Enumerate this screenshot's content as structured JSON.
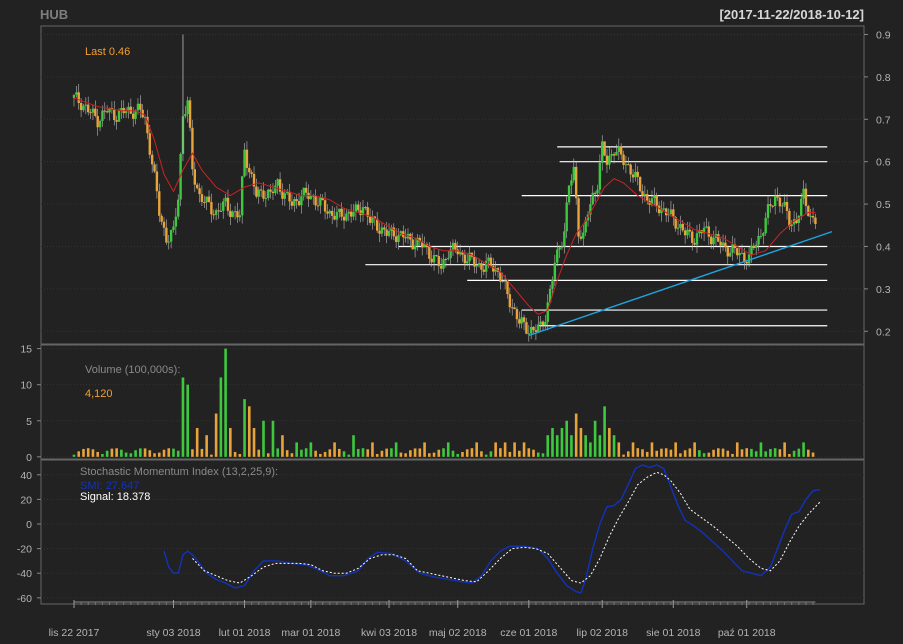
{
  "header": {
    "symbol": "HUB",
    "range": "[2017-11-22/2018-10-12]"
  },
  "colors": {
    "background": "#222222",
    "up_candle": "#3ec83e",
    "down_candle": "#e8a33a",
    "ma_line": "#cc2222",
    "trendline": "#1ea5e0",
    "smi_line": "#1133bb",
    "signal_line": "#ffffff",
    "last_text": "#f0a030"
  },
  "chart_data": [
    {
      "type": "candlestick",
      "panel": "price",
      "annotation_label": "Last",
      "annotation_value": "0.46",
      "yticks": [
        "0.2",
        "0.3",
        "0.4",
        "0.5",
        "0.6",
        "0.7",
        "0.8",
        "0.9"
      ],
      "ylim": [
        0.17,
        0.92
      ],
      "xticks": [
        "lis 22 2017",
        "sty 03 2018",
        "lut 01 2018",
        "mar 01 2018",
        "kwi 03 2018",
        "maj 02 2018",
        "cze 01 2018",
        "lip 02 2018",
        "sie 01 2018",
        "paź 01 2018"
      ],
      "close_path": [
        [
          0,
          0.75
        ],
        [
          3,
          0.74
        ],
        [
          6,
          0.72
        ],
        [
          10,
          0.7
        ],
        [
          14,
          0.72
        ],
        [
          18,
          0.71
        ],
        [
          22,
          0.72
        ],
        [
          25,
          0.72
        ],
        [
          28,
          0.72
        ],
        [
          30,
          0.7
        ],
        [
          33,
          0.6
        ],
        [
          36,
          0.48
        ],
        [
          39,
          0.42
        ],
        [
          42,
          0.43
        ],
        [
          44,
          0.52
        ],
        [
          46,
          0.71
        ],
        [
          48,
          0.74
        ],
        [
          50,
          0.58
        ],
        [
          53,
          0.52
        ],
        [
          56,
          0.5
        ],
        [
          60,
          0.48
        ],
        [
          64,
          0.5
        ],
        [
          67,
          0.48
        ],
        [
          70,
          0.47
        ],
        [
          72,
          0.63
        ],
        [
          74,
          0.58
        ],
        [
          77,
          0.52
        ],
        [
          80,
          0.53
        ],
        [
          83,
          0.52
        ],
        [
          86,
          0.55
        ],
        [
          89,
          0.52
        ],
        [
          92,
          0.5
        ],
        [
          96,
          0.52
        ],
        [
          100,
          0.52
        ],
        [
          104,
          0.5
        ],
        [
          108,
          0.48
        ],
        [
          112,
          0.47
        ],
        [
          116,
          0.48
        ],
        [
          120,
          0.48
        ],
        [
          122,
          0.5
        ],
        [
          125,
          0.46
        ],
        [
          128,
          0.45
        ],
        [
          132,
          0.43
        ],
        [
          136,
          0.43
        ],
        [
          140,
          0.42
        ],
        [
          144,
          0.41
        ],
        [
          148,
          0.4
        ],
        [
          152,
          0.37
        ],
        [
          155,
          0.35
        ],
        [
          158,
          0.39
        ],
        [
          162,
          0.39
        ],
        [
          166,
          0.37
        ],
        [
          170,
          0.36
        ],
        [
          173,
          0.35
        ],
        [
          176,
          0.36
        ],
        [
          179,
          0.34
        ],
        [
          182,
          0.3
        ],
        [
          185,
          0.26
        ],
        [
          188,
          0.22
        ],
        [
          191,
          0.21
        ],
        [
          194,
          0.2
        ],
        [
          197,
          0.21
        ],
        [
          199,
          0.24
        ],
        [
          201,
          0.29
        ],
        [
          203,
          0.36
        ],
        [
          205,
          0.4
        ],
        [
          207,
          0.44
        ],
        [
          209,
          0.54
        ],
        [
          211,
          0.58
        ],
        [
          213,
          0.44
        ],
        [
          215,
          0.42
        ],
        [
          217,
          0.48
        ],
        [
          219,
          0.52
        ],
        [
          221,
          0.55
        ],
        [
          223,
          0.63
        ],
        [
          225,
          0.6
        ],
        [
          228,
          0.63
        ],
        [
          231,
          0.61
        ],
        [
          234,
          0.59
        ],
        [
          238,
          0.55
        ],
        [
          242,
          0.51
        ],
        [
          246,
          0.5
        ],
        [
          250,
          0.48
        ],
        [
          254,
          0.46
        ],
        [
          258,
          0.43
        ],
        [
          262,
          0.42
        ],
        [
          266,
          0.44
        ],
        [
          270,
          0.42
        ],
        [
          274,
          0.4
        ],
        [
          278,
          0.39
        ],
        [
          282,
          0.38
        ],
        [
          285,
          0.37
        ],
        [
          287,
          0.4
        ],
        [
          290,
          0.43
        ],
        [
          293,
          0.48
        ],
        [
          296,
          0.52
        ],
        [
          299,
          0.5
        ],
        [
          302,
          0.46
        ],
        [
          305,
          0.46
        ],
        [
          308,
          0.52
        ],
        [
          311,
          0.47
        ],
        [
          313,
          0.46
        ]
      ],
      "ma_path": [
        [
          0,
          0.75
        ],
        [
          10,
          0.73
        ],
        [
          20,
          0.72
        ],
        [
          26,
          0.72
        ],
        [
          30,
          0.71
        ],
        [
          34,
          0.65
        ],
        [
          38,
          0.57
        ],
        [
          42,
          0.53
        ],
        [
          46,
          0.58
        ],
        [
          50,
          0.62
        ],
        [
          54,
          0.58
        ],
        [
          60,
          0.54
        ],
        [
          66,
          0.52
        ],
        [
          72,
          0.54
        ],
        [
          78,
          0.55
        ],
        [
          84,
          0.54
        ],
        [
          90,
          0.53
        ],
        [
          96,
          0.52
        ],
        [
          102,
          0.52
        ],
        [
          108,
          0.51
        ],
        [
          114,
          0.49
        ],
        [
          120,
          0.48
        ],
        [
          126,
          0.47
        ],
        [
          132,
          0.45
        ],
        [
          138,
          0.43
        ],
        [
          144,
          0.42
        ],
        [
          150,
          0.4
        ],
        [
          156,
          0.39
        ],
        [
          162,
          0.39
        ],
        [
          168,
          0.38
        ],
        [
          174,
          0.36
        ],
        [
          180,
          0.34
        ],
        [
          186,
          0.3
        ],
        [
          192,
          0.26
        ],
        [
          196,
          0.24
        ],
        [
          200,
          0.25
        ],
        [
          204,
          0.32
        ],
        [
          208,
          0.38
        ],
        [
          212,
          0.43
        ],
        [
          216,
          0.46
        ],
        [
          220,
          0.5
        ],
        [
          224,
          0.54
        ],
        [
          228,
          0.56
        ],
        [
          232,
          0.55
        ],
        [
          238,
          0.52
        ],
        [
          244,
          0.5
        ],
        [
          250,
          0.48
        ],
        [
          256,
          0.46
        ],
        [
          262,
          0.44
        ],
        [
          268,
          0.43
        ],
        [
          274,
          0.42
        ],
        [
          280,
          0.4
        ],
        [
          286,
          0.38
        ],
        [
          292,
          0.39
        ],
        [
          298,
          0.43
        ],
        [
          304,
          0.46
        ],
        [
          310,
          0.48
        ],
        [
          313,
          0.48
        ]
      ],
      "support_lines": [
        {
          "from": 204,
          "to": 318,
          "value": 0.635
        },
        {
          "from": 205,
          "to": 318,
          "value": 0.6
        },
        {
          "from": 189,
          "to": 318,
          "value": 0.52
        },
        {
          "from": 137,
          "to": 318,
          "value": 0.4
        },
        {
          "from": 123,
          "to": 318,
          "value": 0.357
        },
        {
          "from": 166,
          "to": 318,
          "value": 0.32
        },
        {
          "from": 189,
          "to": 318,
          "value": 0.25
        },
        {
          "from": 196,
          "to": 318,
          "value": 0.213
        }
      ],
      "trendline": {
        "from": [
          192,
          0.19
        ],
        "to": [
          320,
          0.435
        ]
      }
    },
    {
      "type": "bar",
      "panel": "volume",
      "label": "Volume (100,000s):",
      "last_value": "4,120",
      "yticks": [
        "0",
        "5",
        "10",
        "15"
      ],
      "ylim": [
        -0.3,
        15.5
      ],
      "spikes": [
        [
          46,
          11
        ],
        [
          48,
          10
        ],
        [
          52,
          4
        ],
        [
          56,
          3
        ],
        [
          60,
          6
        ],
        [
          62,
          11
        ],
        [
          64,
          15
        ],
        [
          66,
          4
        ],
        [
          72,
          8
        ],
        [
          74,
          7
        ],
        [
          76,
          4
        ],
        [
          80,
          5
        ],
        [
          84,
          5
        ],
        [
          88,
          3
        ],
        [
          94,
          2
        ],
        [
          100,
          2
        ],
        [
          110,
          2
        ],
        [
          118,
          3
        ],
        [
          126,
          2
        ],
        [
          136,
          2
        ],
        [
          148,
          2
        ],
        [
          158,
          2
        ],
        [
          170,
          2
        ],
        [
          178,
          2
        ],
        [
          182,
          2
        ],
        [
          186,
          2
        ],
        [
          190,
          2
        ],
        [
          200,
          3
        ],
        [
          202,
          4
        ],
        [
          204,
          3
        ],
        [
          206,
          4
        ],
        [
          208,
          5
        ],
        [
          210,
          3
        ],
        [
          212,
          6
        ],
        [
          214,
          4
        ],
        [
          216,
          3
        ],
        [
          218,
          2
        ],
        [
          220,
          5
        ],
        [
          222,
          3
        ],
        [
          224,
          7
        ],
        [
          226,
          4
        ],
        [
          228,
          3
        ],
        [
          230,
          2
        ],
        [
          236,
          2
        ],
        [
          244,
          2
        ],
        [
          254,
          2
        ],
        [
          262,
          2
        ],
        [
          280,
          2
        ],
        [
          290,
          2
        ],
        [
          300,
          2
        ],
        [
          308,
          2
        ]
      ]
    },
    {
      "type": "line",
      "panel": "smi",
      "label": "Stochastic Momentum Index (13,2,25,9):",
      "series": [
        {
          "name": "SMI",
          "value_label": "27.647"
        },
        {
          "name": "Signal",
          "value_label": "18.378"
        }
      ],
      "yticks": [
        "-60",
        "-40",
        "-20",
        "0",
        "20",
        "40"
      ],
      "ylim": [
        -65,
        52
      ],
      "smi_path": [
        [
          38,
          -22
        ],
        [
          40,
          -35
        ],
        [
          42,
          -40
        ],
        [
          44,
          -40
        ],
        [
          46,
          -25
        ],
        [
          48,
          -22
        ],
        [
          50,
          -25
        ],
        [
          53,
          -32
        ],
        [
          56,
          -40
        ],
        [
          60,
          -45
        ],
        [
          64,
          -48
        ],
        [
          68,
          -52
        ],
        [
          72,
          -50
        ],
        [
          76,
          -38
        ],
        [
          80,
          -30
        ],
        [
          86,
          -30
        ],
        [
          92,
          -32
        ],
        [
          98,
          -33
        ],
        [
          104,
          -38
        ],
        [
          108,
          -42
        ],
        [
          114,
          -42
        ],
        [
          120,
          -38
        ],
        [
          124,
          -28
        ],
        [
          128,
          -23
        ],
        [
          134,
          -24
        ],
        [
          140,
          -30
        ],
        [
          146,
          -40
        ],
        [
          152,
          -43
        ],
        [
          158,
          -45
        ],
        [
          164,
          -47
        ],
        [
          168,
          -48
        ],
        [
          172,
          -42
        ],
        [
          176,
          -30
        ],
        [
          180,
          -22
        ],
        [
          184,
          -18
        ],
        [
          190,
          -18
        ],
        [
          196,
          -20
        ],
        [
          200,
          -28
        ],
        [
          204,
          -40
        ],
        [
          208,
          -50
        ],
        [
          212,
          -55
        ],
        [
          214,
          -56
        ],
        [
          216,
          -45
        ],
        [
          219,
          -20
        ],
        [
          222,
          0
        ],
        [
          225,
          14
        ],
        [
          228,
          15
        ],
        [
          231,
          20
        ],
        [
          234,
          32
        ],
        [
          237,
          45
        ],
        [
          240,
          48
        ],
        [
          243,
          46
        ],
        [
          246,
          48
        ],
        [
          249,
          45
        ],
        [
          252,
          30
        ],
        [
          255,
          15
        ],
        [
          258,
          3
        ],
        [
          262,
          -2
        ],
        [
          266,
          -8
        ],
        [
          270,
          -15
        ],
        [
          274,
          -22
        ],
        [
          278,
          -30
        ],
        [
          282,
          -38
        ],
        [
          286,
          -40
        ],
        [
          290,
          -42
        ],
        [
          294,
          -35
        ],
        [
          297,
          -20
        ],
        [
          300,
          -5
        ],
        [
          303,
          8
        ],
        [
          306,
          10
        ],
        [
          309,
          20
        ],
        [
          312,
          27
        ],
        [
          315,
          28
        ]
      ],
      "signal_path": [
        [
          50,
          -28
        ],
        [
          55,
          -38
        ],
        [
          60,
          -42
        ],
        [
          65,
          -46
        ],
        [
          70,
          -48
        ],
        [
          75,
          -42
        ],
        [
          80,
          -35
        ],
        [
          85,
          -32
        ],
        [
          90,
          -32
        ],
        [
          95,
          -32
        ],
        [
          100,
          -33
        ],
        [
          105,
          -38
        ],
        [
          110,
          -40
        ],
        [
          115,
          -40
        ],
        [
          120,
          -36
        ],
        [
          125,
          -28
        ],
        [
          130,
          -25
        ],
        [
          135,
          -25
        ],
        [
          140,
          -28
        ],
        [
          145,
          -38
        ],
        [
          150,
          -40
        ],
        [
          155,
          -42
        ],
        [
          160,
          -44
        ],
        [
          165,
          -46
        ],
        [
          170,
          -47
        ],
        [
          175,
          -38
        ],
        [
          180,
          -28
        ],
        [
          185,
          -20
        ],
        [
          190,
          -19
        ],
        [
          195,
          -20
        ],
        [
          200,
          -24
        ],
        [
          205,
          -35
        ],
        [
          210,
          -46
        ],
        [
          214,
          -48
        ],
        [
          218,
          -42
        ],
        [
          222,
          -28
        ],
        [
          226,
          -10
        ],
        [
          230,
          5
        ],
        [
          234,
          18
        ],
        [
          238,
          32
        ],
        [
          242,
          38
        ],
        [
          246,
          42
        ],
        [
          249,
          40
        ],
        [
          252,
          35
        ],
        [
          256,
          25
        ],
        [
          260,
          12
        ],
        [
          265,
          5
        ],
        [
          270,
          -2
        ],
        [
          275,
          -10
        ],
        [
          280,
          -18
        ],
        [
          285,
          -28
        ],
        [
          290,
          -36
        ],
        [
          294,
          -38
        ],
        [
          298,
          -30
        ],
        [
          302,
          -15
        ],
        [
          306,
          -2
        ],
        [
          310,
          8
        ],
        [
          315,
          18
        ]
      ]
    }
  ]
}
